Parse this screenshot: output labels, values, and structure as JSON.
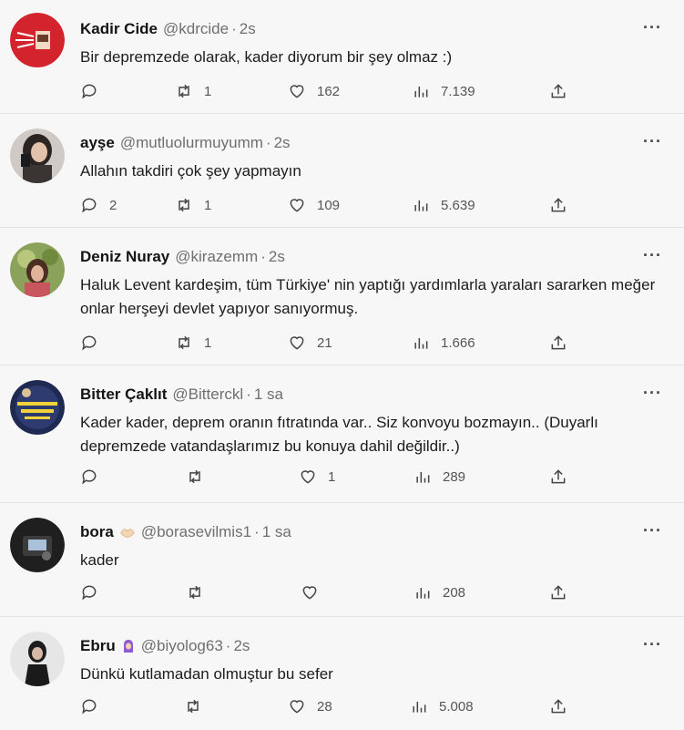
{
  "tweets": [
    {
      "name": "Kadir Cide",
      "handle": "@kdrcide",
      "sep": "·",
      "time": "2s",
      "text": "Bir depremzede olarak, kader diyorum bir şey olmaz :)",
      "replies": "",
      "retweets": "1",
      "likes": "162",
      "views": "7.139",
      "more": "···"
    },
    {
      "name": "ayşe",
      "handle": "@mutluolurmuyumm",
      "sep": "·",
      "time": "2s",
      "text": "Allahın takdiri çok şey yapmayın",
      "replies": "2",
      "retweets": "1",
      "likes": "109",
      "views": "5.639",
      "more": "···"
    },
    {
      "name": "Deniz Nuray",
      "handle": "@kirazemm",
      "sep": "·",
      "time": "2s",
      "text": "Haluk Levent kardeşim, tüm Türkiye' nin yaptığı yardımlarla yaraları sararken meğer onlar herşeyi devlet yapıyor sanıyormuş.",
      "replies": "",
      "retweets": "1",
      "likes": "21",
      "views": "1.666",
      "more": "···"
    },
    {
      "name": "Bitter Çaklıt",
      "handle": "@Bitterckl",
      "sep": "·",
      "time": "1 sa",
      "text": "Kader kader, deprem oranın fıtratında var.. Siz konvoyu bozmayın.. (Duyarlı depremzede vatandaşlarımız bu konuya dahil değildir..)",
      "replies": "",
      "retweets": "",
      "likes": "1",
      "views": "289",
      "more": "···"
    },
    {
      "name": "bora",
      "handle": "@borasevilmis1",
      "sep": "·",
      "time": "1 sa",
      "text": "kader",
      "replies": "",
      "retweets": "",
      "likes": "",
      "views": "208",
      "more": "···"
    },
    {
      "name": "Ebru",
      "handle": "@biyolog63",
      "sep": "·",
      "time": "2s",
      "text": "Dünkü kutlamadan olmuştur bu sefer",
      "replies": "",
      "retweets": "",
      "likes": "28",
      "views": "5.008",
      "more": "···"
    }
  ],
  "icons": {
    "reply": "reply-icon",
    "retweet": "retweet-icon",
    "like": "heart-icon",
    "views": "views-icon",
    "share": "share-icon",
    "more": "more-icon"
  },
  "colors": {
    "background": "#f7f7f7",
    "text": "#1a1a1a",
    "muted": "#6f6f6f"
  }
}
